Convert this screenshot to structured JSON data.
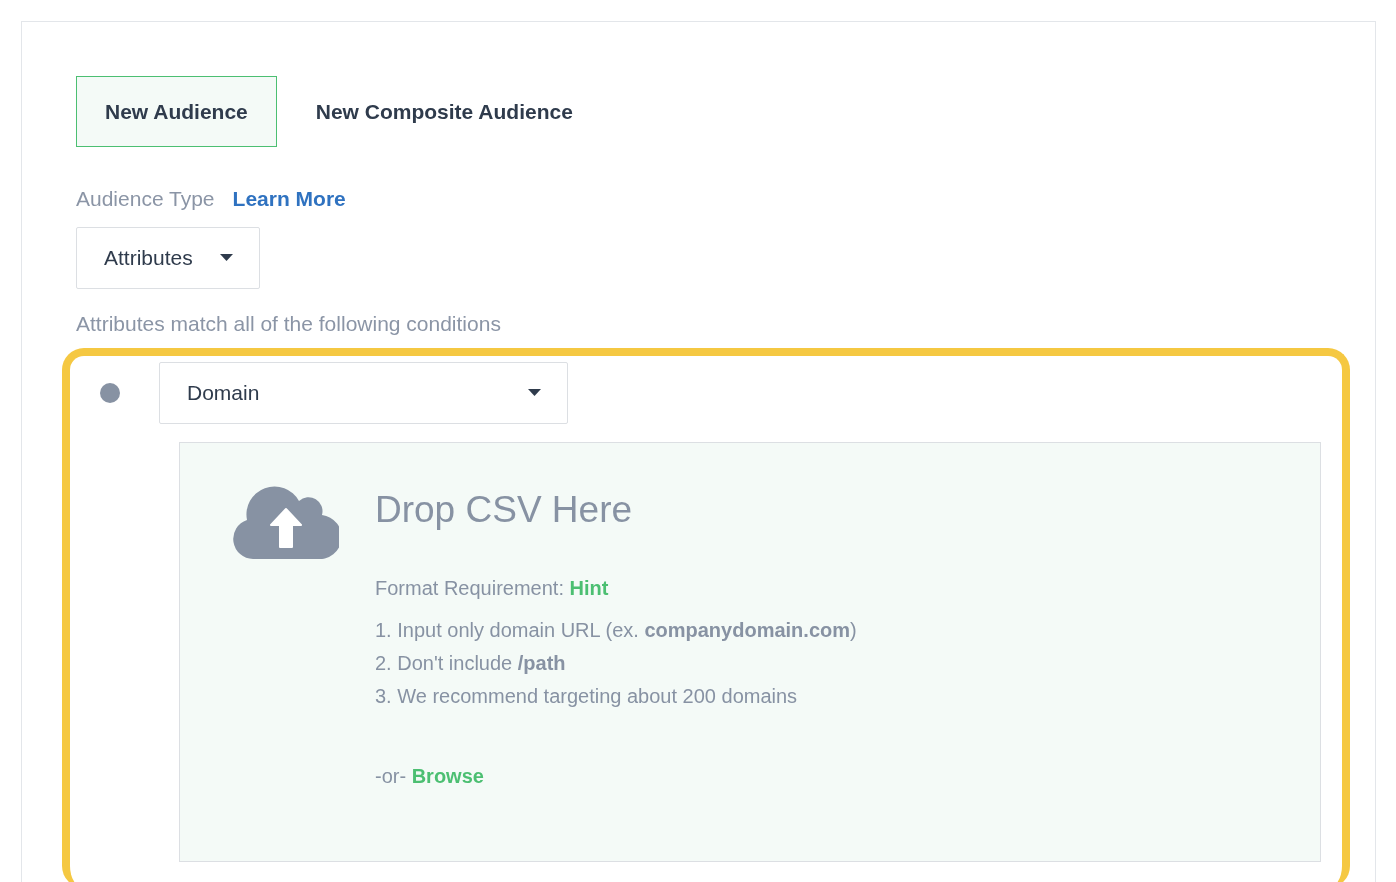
{
  "tabs": [
    {
      "label": "New Audience",
      "selected": true
    },
    {
      "label": "New Composite Audience",
      "selected": false
    }
  ],
  "audience_type": {
    "label": "Audience Type",
    "link": "Learn More"
  },
  "type_dropdown": {
    "value": "Attributes"
  },
  "conditions_text": "Attributes match all of the following conditions",
  "condition": {
    "highlighted": true,
    "field": "Domain"
  },
  "dropzone": {
    "title": "Drop CSV Here",
    "format_label": "Format Requirement:",
    "hint_link": "Hint",
    "requirements": [
      "1. Input only domain URL (ex. **companydomain.com**)",
      "2. Don't include **/path**",
      "3. We recommend targeting about 200 domains"
    ],
    "or_text": "-or-",
    "browse_link": "Browse"
  }
}
